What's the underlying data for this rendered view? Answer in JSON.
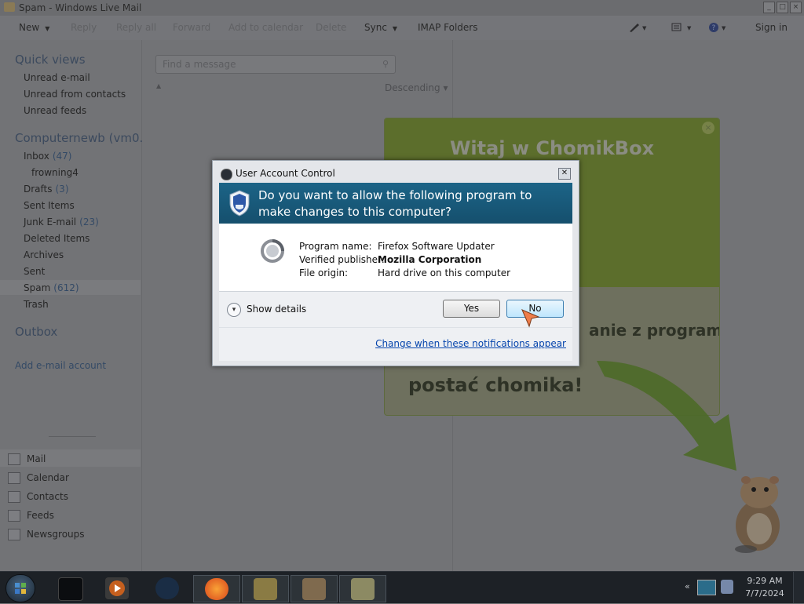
{
  "window": {
    "title": "Spam - Windows Live Mail"
  },
  "toolbar": {
    "new": "New",
    "reply": "Reply",
    "reply_all": "Reply all",
    "forward": "Forward",
    "add_to_calendar": "Add to calendar",
    "delete": "Delete",
    "sync": "Sync",
    "imap_folders": "IMAP Folders",
    "sign_in": "Sign in"
  },
  "nav": {
    "quick_views": {
      "heading": "Quick views",
      "items": [
        "Unread e-mail",
        "Unread from contacts",
        "Unread feeds"
      ]
    },
    "account": {
      "heading": "Computernewb (vm0...",
      "folders": [
        {
          "label": "Inbox",
          "count": "(47)"
        },
        {
          "label": "frowning4",
          "count": ""
        },
        {
          "label": "Drafts",
          "count": "(3)"
        },
        {
          "label": "Sent Items",
          "count": ""
        },
        {
          "label": "Junk E-mail",
          "count": "(23)"
        },
        {
          "label": "Deleted Items",
          "count": ""
        },
        {
          "label": "Archives",
          "count": ""
        },
        {
          "label": "Sent",
          "count": ""
        },
        {
          "label": "Spam",
          "count": "(612)"
        },
        {
          "label": "Trash",
          "count": ""
        }
      ]
    },
    "outbox": "Outbox",
    "add_account": "Add e-mail account",
    "bottom": [
      "Mail",
      "Calendar",
      "Contacts",
      "Feeds",
      "Newsgroups"
    ]
  },
  "message_list": {
    "search_placeholder": "Find a message",
    "sort_label": "Descending"
  },
  "promo": {
    "heading": "Witaj w ChomikBox",
    "line1": "anie z programu,",
    "line2": "postać chomika!"
  },
  "uac": {
    "title": "User Account Control",
    "question": "Do you want to allow the following program to make changes to this computer?",
    "fields": [
      {
        "key": "Program name:",
        "value": "Firefox Software Updater",
        "bold": false
      },
      {
        "key": "Verified publisher:",
        "value": "Mozilla Corporation",
        "bold": true
      },
      {
        "key": "File origin:",
        "value": "Hard drive on this computer",
        "bold": false
      }
    ],
    "show_details": "Show details",
    "yes": "Yes",
    "no": "No",
    "change_link": "Change when these notifications appear",
    "banner_color": "#1c6487"
  },
  "taskbar": {
    "time": "9:29 AM",
    "date": "7/7/2024",
    "tray_overflow": "«"
  }
}
